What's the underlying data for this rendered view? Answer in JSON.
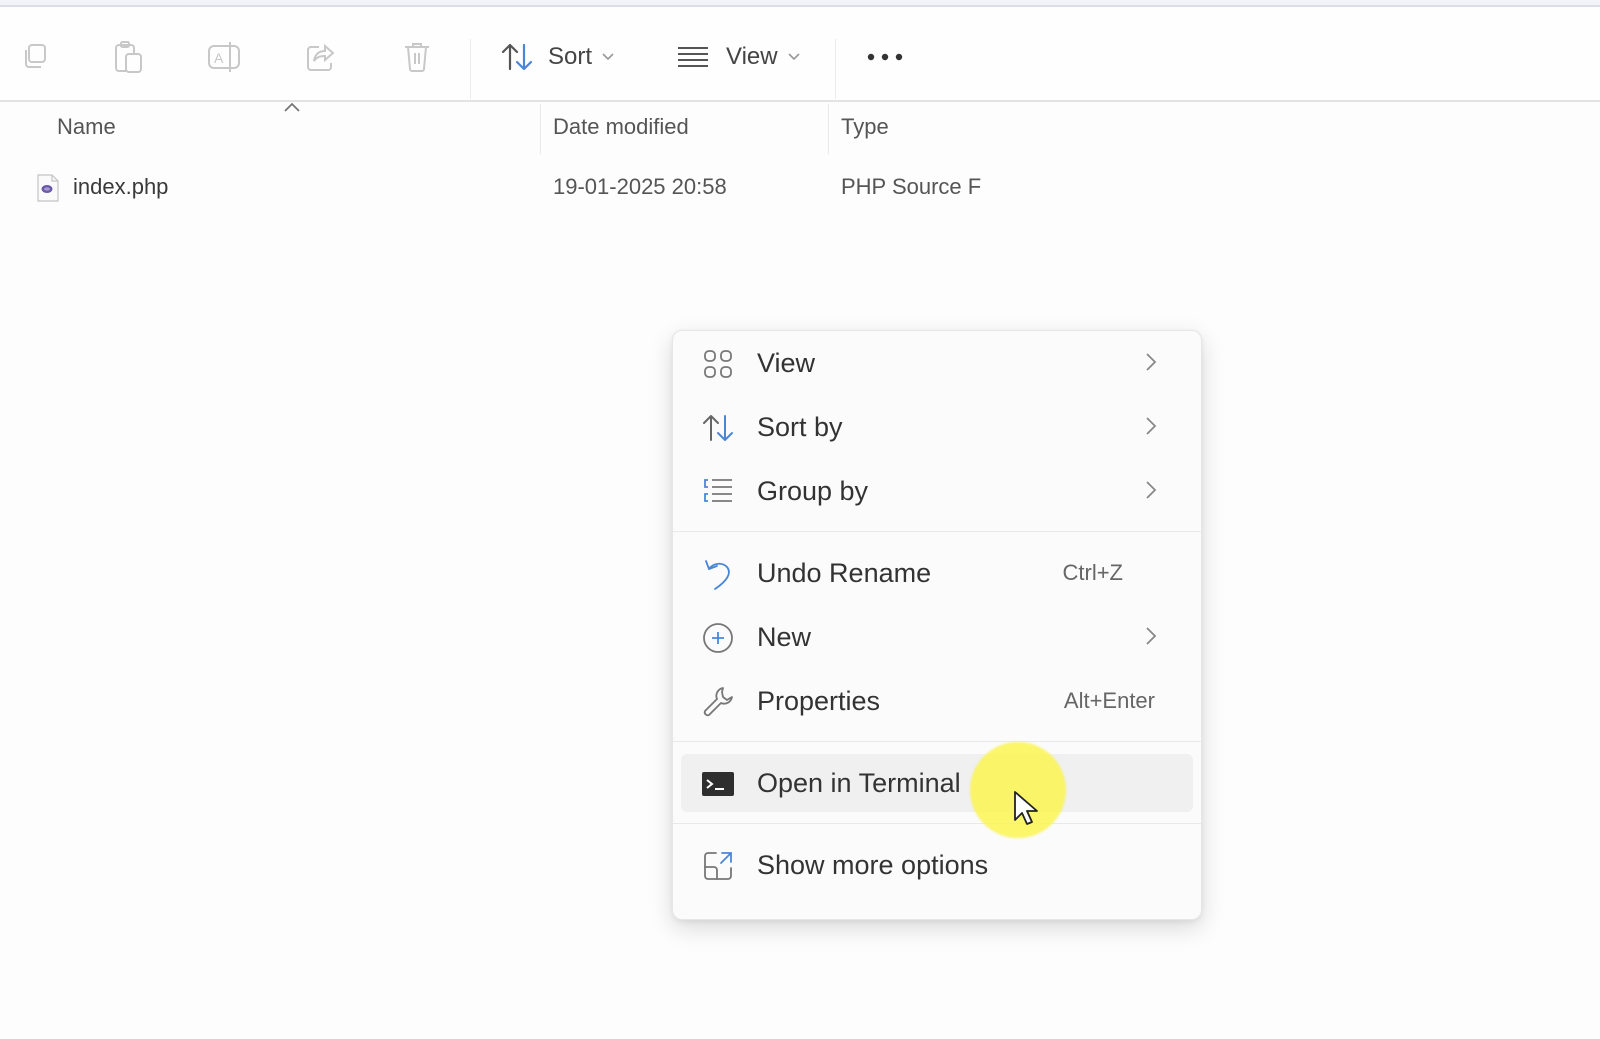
{
  "toolbar": {
    "icons": [
      {
        "name": "copy-icon"
      },
      {
        "name": "paste-icon"
      },
      {
        "name": "rename-icon"
      },
      {
        "name": "share-icon"
      },
      {
        "name": "delete-icon"
      }
    ],
    "sort_label": "Sort",
    "view_label": "View",
    "more_label": "•••",
    "accent_color": "#4a86d8"
  },
  "columns": {
    "name": "Name",
    "date_modified": "Date modified",
    "type": "Type"
  },
  "files": [
    {
      "name": "index.php",
      "date_modified": "19-01-2025 20:58",
      "type": "PHP Source F",
      "icon": "php-file-icon"
    }
  ],
  "context_menu": {
    "items": [
      {
        "label": "View",
        "icon": "grid-view-icon",
        "submenu": true
      },
      {
        "label": "Sort by",
        "icon": "sort-icon",
        "submenu": true
      },
      {
        "label": "Group by",
        "icon": "group-by-icon",
        "submenu": true
      },
      {
        "label": "Undo Rename",
        "icon": "undo-icon",
        "shortcut": "Ctrl+Z"
      },
      {
        "label": "New",
        "icon": "new-plus-icon",
        "submenu": true
      },
      {
        "label": "Properties",
        "icon": "wrench-icon",
        "shortcut": "Alt+Enter"
      },
      {
        "label": "Open in Terminal",
        "icon": "terminal-icon",
        "hovered": true
      },
      {
        "label": "Show more options",
        "icon": "show-more-options-icon"
      }
    ]
  }
}
